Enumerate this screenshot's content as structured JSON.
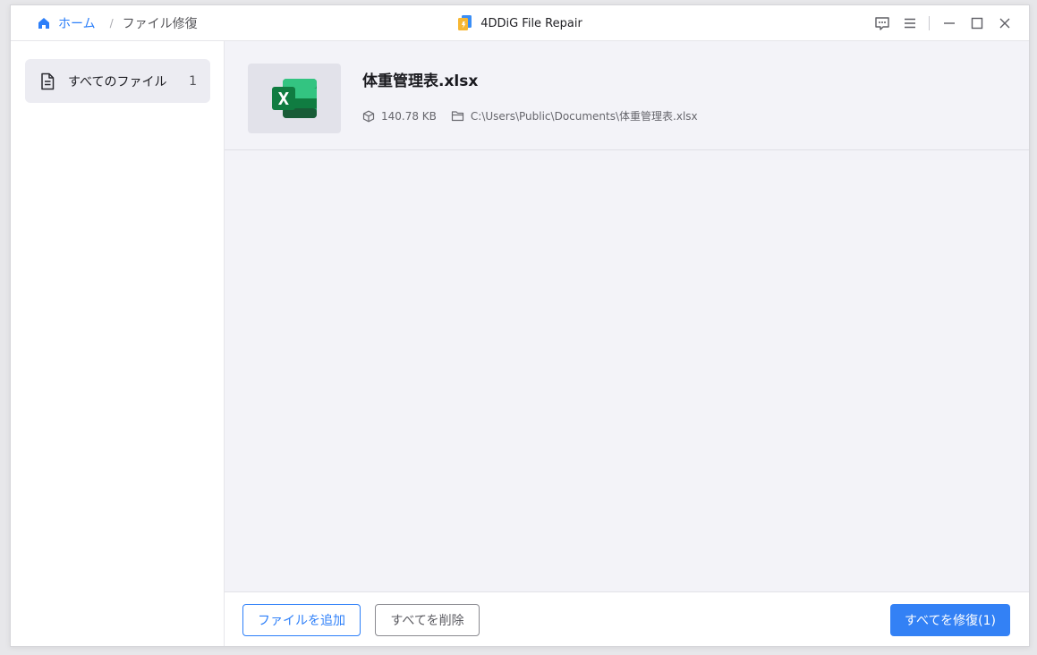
{
  "titlebar": {
    "breadcrumb": {
      "home": "ホーム",
      "separator": "/",
      "current": "ファイル修復"
    },
    "app_title": "4DDiG File Repair",
    "controls": [
      "feedback-icon",
      "menu-icon",
      "minimize-icon",
      "maximize-icon",
      "close-icon"
    ]
  },
  "sidebar": {
    "items": [
      {
        "label": "すべてのファイル",
        "count": "1",
        "icon": "document-icon"
      }
    ]
  },
  "file": {
    "name": "体重管理表.xlsx",
    "size": "140.78 KB",
    "path": "C:\\Users\\Public\\Documents\\体重管理表.xlsx",
    "type_icon": "excel-icon"
  },
  "bottom": {
    "add_label": "ファイルを追加",
    "delete_label": "すべてを削除",
    "repair_label": "すべてを修復(1)"
  },
  "colors": {
    "accent": "#2d7ff9",
    "primary_button": "#3381f5",
    "main_background": "#f3f3f8",
    "sidebar_selected": "#ececf2",
    "excel_green": "#1d9a5b"
  }
}
